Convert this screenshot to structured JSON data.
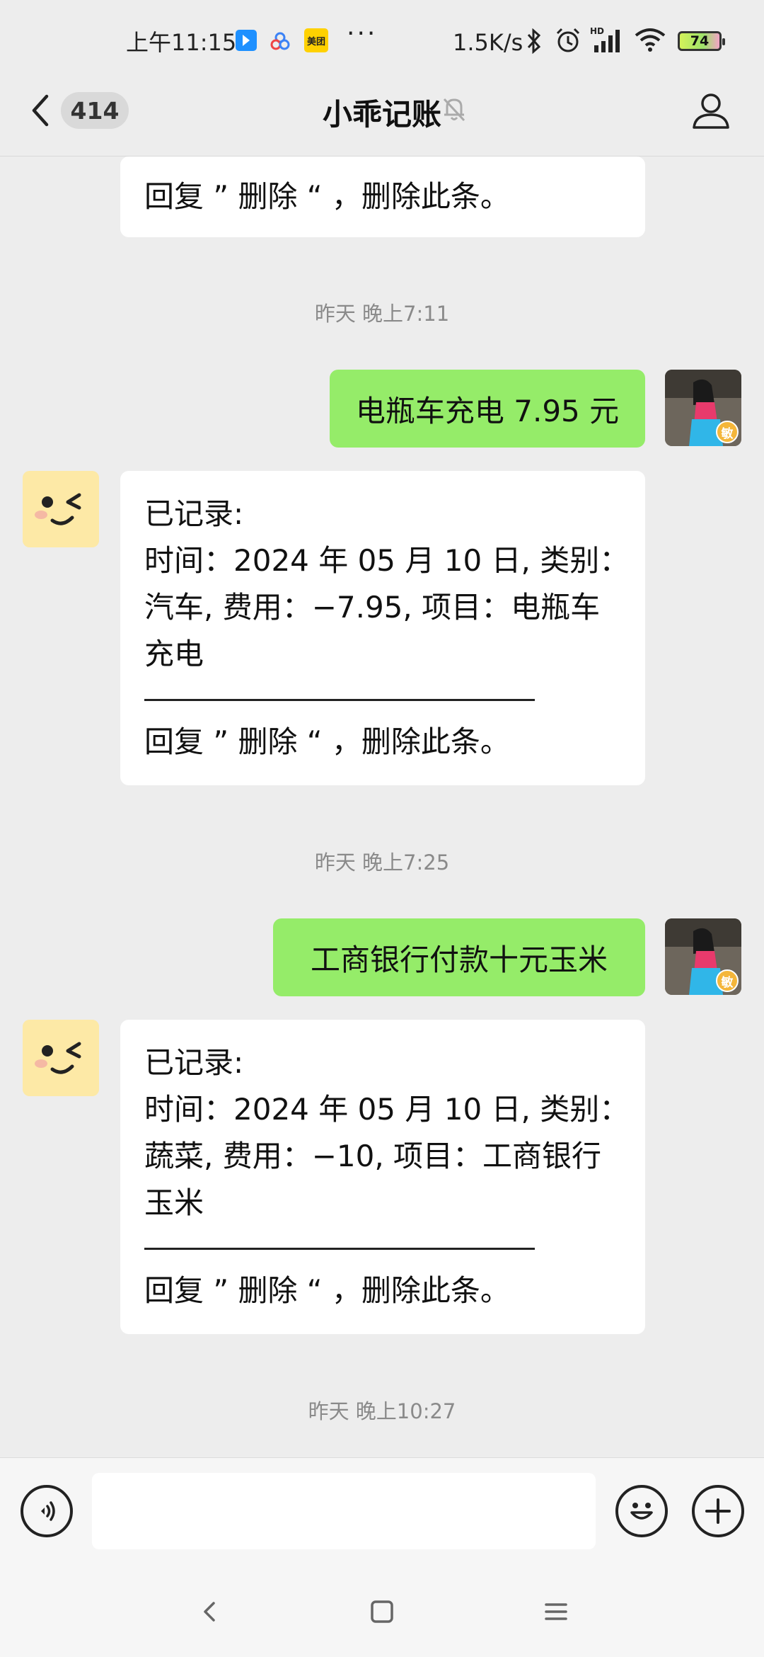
{
  "status_bar": {
    "time": "上午11:15",
    "net_speed": "1.5K/s",
    "battery": "74",
    "icons": [
      "app-notification-icon",
      "baidu-icon",
      "meituan-icon",
      "more-dots-icon",
      "bluetooth-icon",
      "alarm-icon",
      "signal-icon",
      "wifi-icon",
      "battery-icon"
    ],
    "meituan_label": "美团"
  },
  "header": {
    "unread_count": "414",
    "title": "小乖记账",
    "icons": [
      "back-chevron-icon",
      "mute-bell-icon",
      "profile-icon"
    ]
  },
  "messages": {
    "top_partial": "回复 ” 删除 “ ，删除此条。",
    "time1": "昨天 晚上7:11",
    "sent1": "电瓶车充电 7.95 元",
    "bot1": {
      "line1": "已记录:",
      "line2": "时间：2024 年 05 月 10 日, 类别：",
      "line3": "汽车, 费用：−7.95, 项目：电瓶车",
      "line4": "充电",
      "footer": "回复 ” 删除 “ ，删除此条。"
    },
    "time2": "昨天 晚上7:25",
    "sent2": "工商银行付款十元玉米",
    "bot2": {
      "line1": "已记录:",
      "line2": "时间：2024 年 05 月 10 日, 类别：",
      "line3": "蔬菜, 费用：−10, 项目：工商银行",
      "line4": "玉米",
      "footer": "回复 ” 删除 “ ，删除此条。"
    },
    "time3": "昨天 晚上10:27",
    "avatar_badge": "敏"
  },
  "composer": {
    "input_value": "",
    "icons": [
      "voice-icon",
      "emoji-icon",
      "plus-icon"
    ]
  },
  "nav": {
    "icons": [
      "nav-back-icon",
      "nav-home-icon",
      "nav-menu-icon"
    ]
  }
}
